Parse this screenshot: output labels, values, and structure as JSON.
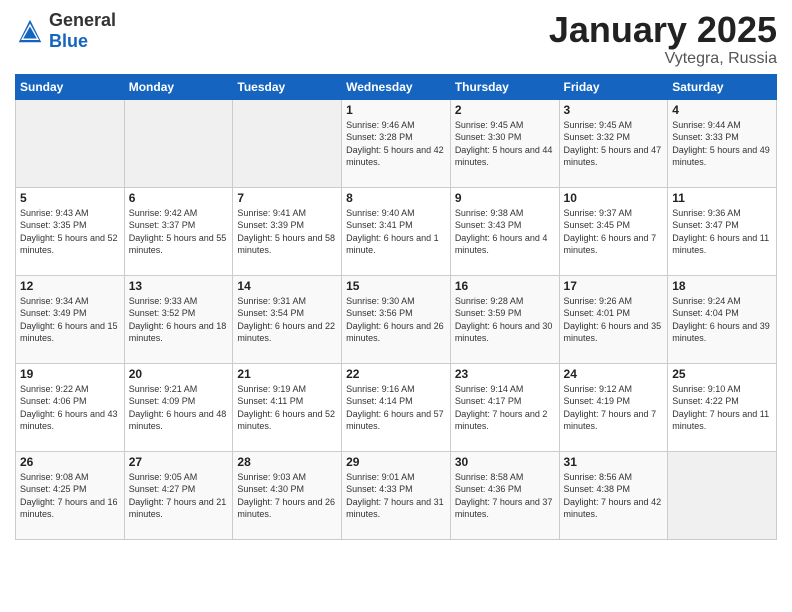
{
  "logo": {
    "general": "General",
    "blue": "Blue"
  },
  "header": {
    "month": "January 2025",
    "location": "Vytegra, Russia"
  },
  "days_of_week": [
    "Sunday",
    "Monday",
    "Tuesday",
    "Wednesday",
    "Thursday",
    "Friday",
    "Saturday"
  ],
  "weeks": [
    [
      {
        "day": "",
        "content": ""
      },
      {
        "day": "",
        "content": ""
      },
      {
        "day": "",
        "content": ""
      },
      {
        "day": "1",
        "content": "Sunrise: 9:46 AM\nSunset: 3:28 PM\nDaylight: 5 hours and 42 minutes."
      },
      {
        "day": "2",
        "content": "Sunrise: 9:45 AM\nSunset: 3:30 PM\nDaylight: 5 hours and 44 minutes."
      },
      {
        "day": "3",
        "content": "Sunrise: 9:45 AM\nSunset: 3:32 PM\nDaylight: 5 hours and 47 minutes."
      },
      {
        "day": "4",
        "content": "Sunrise: 9:44 AM\nSunset: 3:33 PM\nDaylight: 5 hours and 49 minutes."
      }
    ],
    [
      {
        "day": "5",
        "content": "Sunrise: 9:43 AM\nSunset: 3:35 PM\nDaylight: 5 hours and 52 minutes."
      },
      {
        "day": "6",
        "content": "Sunrise: 9:42 AM\nSunset: 3:37 PM\nDaylight: 5 hours and 55 minutes."
      },
      {
        "day": "7",
        "content": "Sunrise: 9:41 AM\nSunset: 3:39 PM\nDaylight: 5 hours and 58 minutes."
      },
      {
        "day": "8",
        "content": "Sunrise: 9:40 AM\nSunset: 3:41 PM\nDaylight: 6 hours and 1 minute."
      },
      {
        "day": "9",
        "content": "Sunrise: 9:38 AM\nSunset: 3:43 PM\nDaylight: 6 hours and 4 minutes."
      },
      {
        "day": "10",
        "content": "Sunrise: 9:37 AM\nSunset: 3:45 PM\nDaylight: 6 hours and 7 minutes."
      },
      {
        "day": "11",
        "content": "Sunrise: 9:36 AM\nSunset: 3:47 PM\nDaylight: 6 hours and 11 minutes."
      }
    ],
    [
      {
        "day": "12",
        "content": "Sunrise: 9:34 AM\nSunset: 3:49 PM\nDaylight: 6 hours and 15 minutes."
      },
      {
        "day": "13",
        "content": "Sunrise: 9:33 AM\nSunset: 3:52 PM\nDaylight: 6 hours and 18 minutes."
      },
      {
        "day": "14",
        "content": "Sunrise: 9:31 AM\nSunset: 3:54 PM\nDaylight: 6 hours and 22 minutes."
      },
      {
        "day": "15",
        "content": "Sunrise: 9:30 AM\nSunset: 3:56 PM\nDaylight: 6 hours and 26 minutes."
      },
      {
        "day": "16",
        "content": "Sunrise: 9:28 AM\nSunset: 3:59 PM\nDaylight: 6 hours and 30 minutes."
      },
      {
        "day": "17",
        "content": "Sunrise: 9:26 AM\nSunset: 4:01 PM\nDaylight: 6 hours and 35 minutes."
      },
      {
        "day": "18",
        "content": "Sunrise: 9:24 AM\nSunset: 4:04 PM\nDaylight: 6 hours and 39 minutes."
      }
    ],
    [
      {
        "day": "19",
        "content": "Sunrise: 9:22 AM\nSunset: 4:06 PM\nDaylight: 6 hours and 43 minutes."
      },
      {
        "day": "20",
        "content": "Sunrise: 9:21 AM\nSunset: 4:09 PM\nDaylight: 6 hours and 48 minutes."
      },
      {
        "day": "21",
        "content": "Sunrise: 9:19 AM\nSunset: 4:11 PM\nDaylight: 6 hours and 52 minutes."
      },
      {
        "day": "22",
        "content": "Sunrise: 9:16 AM\nSunset: 4:14 PM\nDaylight: 6 hours and 57 minutes."
      },
      {
        "day": "23",
        "content": "Sunrise: 9:14 AM\nSunset: 4:17 PM\nDaylight: 7 hours and 2 minutes."
      },
      {
        "day": "24",
        "content": "Sunrise: 9:12 AM\nSunset: 4:19 PM\nDaylight: 7 hours and 7 minutes."
      },
      {
        "day": "25",
        "content": "Sunrise: 9:10 AM\nSunset: 4:22 PM\nDaylight: 7 hours and 11 minutes."
      }
    ],
    [
      {
        "day": "26",
        "content": "Sunrise: 9:08 AM\nSunset: 4:25 PM\nDaylight: 7 hours and 16 minutes."
      },
      {
        "day": "27",
        "content": "Sunrise: 9:05 AM\nSunset: 4:27 PM\nDaylight: 7 hours and 21 minutes."
      },
      {
        "day": "28",
        "content": "Sunrise: 9:03 AM\nSunset: 4:30 PM\nDaylight: 7 hours and 26 minutes."
      },
      {
        "day": "29",
        "content": "Sunrise: 9:01 AM\nSunset: 4:33 PM\nDaylight: 7 hours and 31 minutes."
      },
      {
        "day": "30",
        "content": "Sunrise: 8:58 AM\nSunset: 4:36 PM\nDaylight: 7 hours and 37 minutes."
      },
      {
        "day": "31",
        "content": "Sunrise: 8:56 AM\nSunset: 4:38 PM\nDaylight: 7 hours and 42 minutes."
      },
      {
        "day": "",
        "content": ""
      }
    ]
  ]
}
